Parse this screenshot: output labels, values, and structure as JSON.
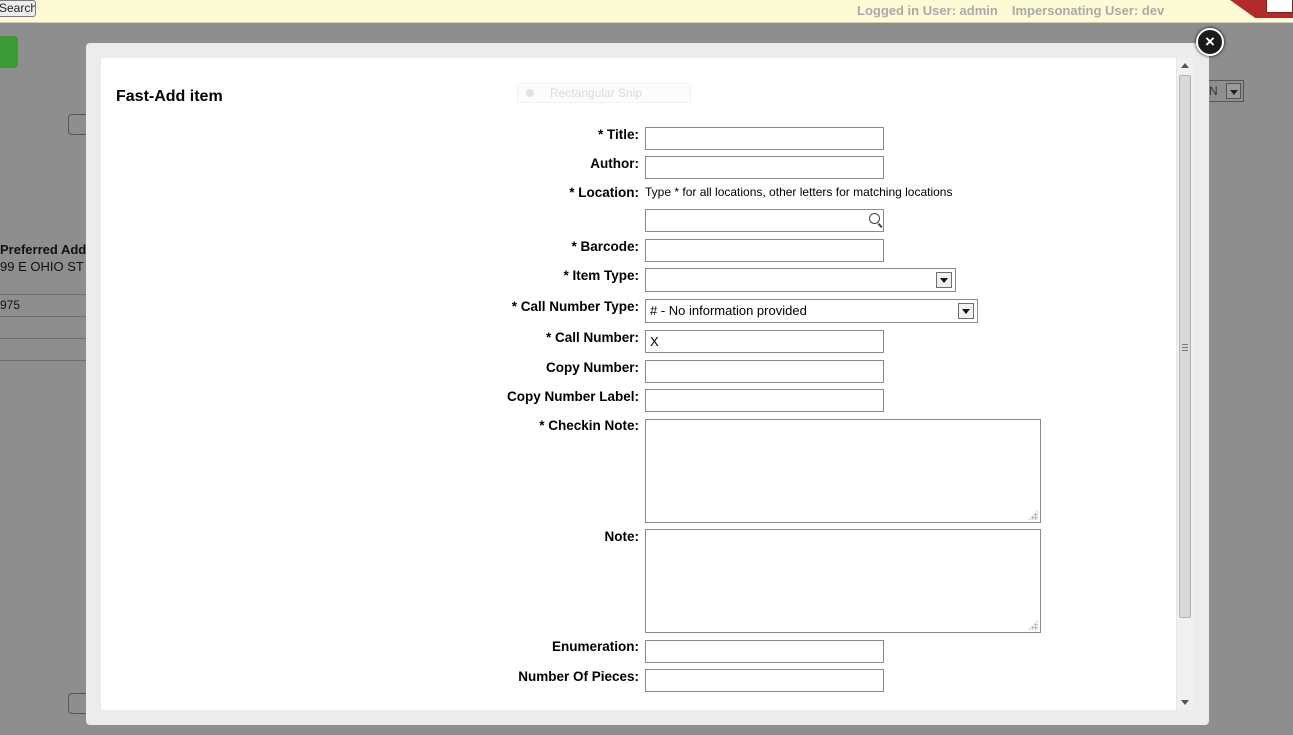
{
  "background": {
    "search_button_label": "Search",
    "logged_in_user": "Logged in User: admin",
    "impersonating_user": "Impersonating User: dev",
    "preferred_address_label": "Preferred Address",
    "preferred_address_value": "99 E OHIO ST",
    "field_value": "975",
    "select_value": "N"
  },
  "modal": {
    "title": "Fast-Add item",
    "close_label": "×",
    "snip_overlay": "Rectangular Snip"
  },
  "form": {
    "title_label": "* Title:",
    "title_value": "",
    "author_label": "Author:",
    "author_value": "",
    "location_label": "* Location:",
    "location_hint": "Type * for all locations, other letters for matching locations",
    "location_value": "",
    "barcode_label": "* Barcode:",
    "barcode_value": "",
    "item_type_label": "* Item Type:",
    "item_type_value": "",
    "call_number_type_label": "* Call Number Type:",
    "call_number_type_value": "# - No information provided",
    "call_number_label": "* Call Number:",
    "call_number_value": "X",
    "copy_number_label": "Copy Number:",
    "copy_number_value": "",
    "copy_number_label_label": "Copy Number Label:",
    "copy_number_label_value": "",
    "checkin_note_label": "* Checkin Note:",
    "checkin_note_value": "",
    "note_label": "Note:",
    "note_value": "",
    "enumeration_label": "Enumeration:",
    "enumeration_value": "",
    "number_of_pieces_label": "Number Of Pieces:",
    "number_of_pieces_value": ""
  }
}
